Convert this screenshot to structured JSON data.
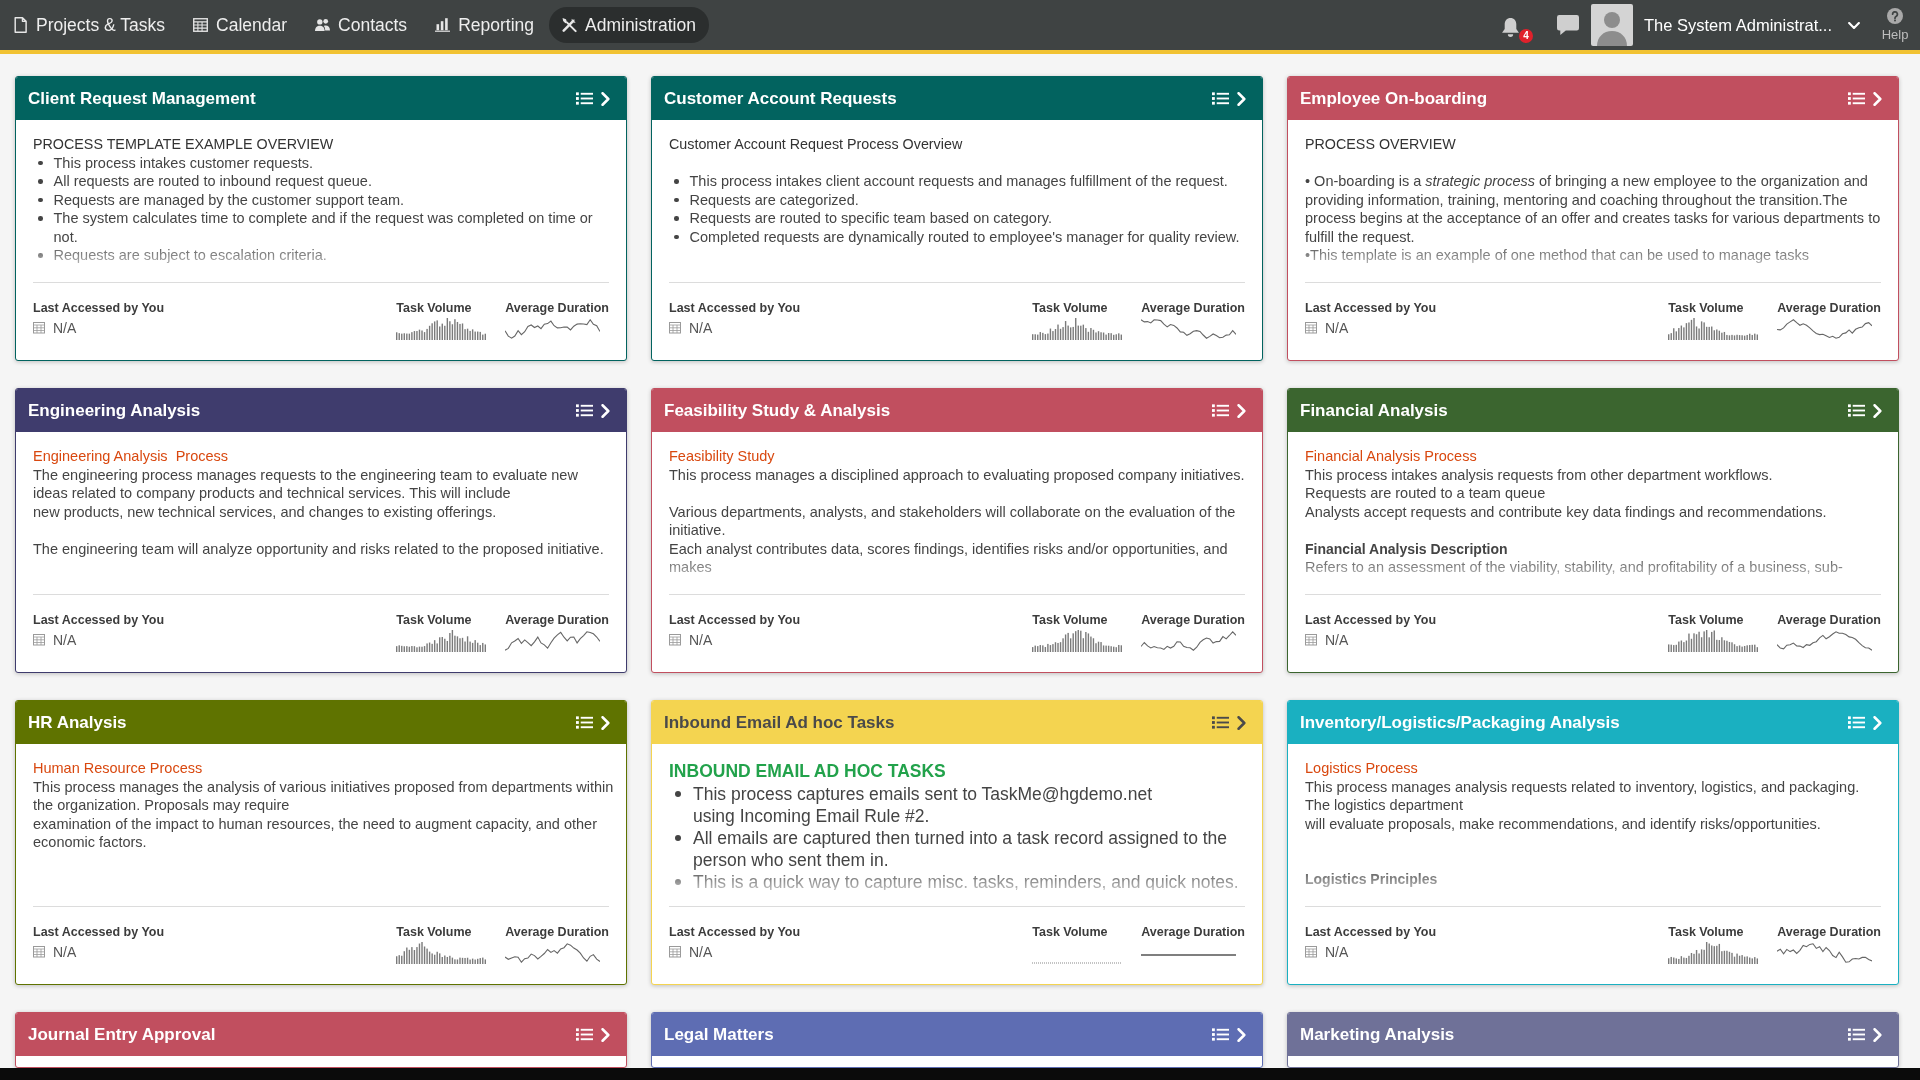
{
  "nav": {
    "items": [
      {
        "label": "Projects & Tasks",
        "selected": false
      },
      {
        "label": "Calendar",
        "selected": false
      },
      {
        "label": "Contacts",
        "selected": false
      },
      {
        "label": "Reporting",
        "selected": false
      },
      {
        "label": "Administration",
        "selected": true
      }
    ]
  },
  "notifications": {
    "count": "4"
  },
  "user": {
    "name": "The System Administrat..."
  },
  "help": {
    "label": "Help"
  },
  "cards": [
    {
      "title": "Client Request Management",
      "color": "#02635f",
      "body": [
        {
          "kind": "heading",
          "text": "PROCESS TEMPLATE EXAMPLE OVERVIEW"
        },
        {
          "kind": "bullets",
          "items": [
            "This process intakes customer requests.",
            "All requests are routed to inbound request queue.",
            "Requests are managed by the customer support team.",
            "The system calculates time to complete and if the request was completed on time or not.",
            "Requests are subject to escalation criteria."
          ]
        }
      ],
      "footer": {
        "last_accessed_label": "Last Accessed by You",
        "last_accessed_value": "N/A",
        "task_volume_label": "Task Volume",
        "average_duration_label": "Average Duration",
        "activity": true
      }
    },
    {
      "title": "Customer Account Requests",
      "color": "#02635f",
      "body": [
        {
          "kind": "heading",
          "text": "Customer Account Request Process Overview"
        },
        {
          "kind": "blank"
        },
        {
          "kind": "bullets",
          "items": [
            "This process intakes client account requests and manages fulfillment of the request.",
            "Requests are categorized.",
            "Requests are routed to specific team based on category.",
            "Completed requests are dynamically routed to employee's manager for quality review."
          ]
        }
      ],
      "footer": {
        "last_accessed_label": "Last Accessed by You",
        "last_accessed_value": "N/A",
        "task_volume_label": "Task Volume",
        "average_duration_label": "Average Duration",
        "activity": true
      }
    },
    {
      "title": "Employee On-boarding",
      "color": "#c14f5f",
      "body": [
        {
          "kind": "heading",
          "text": "PROCESS OVERVIEW"
        },
        {
          "kind": "blank"
        },
        {
          "kind": "paragraph",
          "text": "• On-boarding is a *strategic process* of bringing a new employee to the organization and providing information, training, mentoring and coaching throughout the transition.The process begins at the acceptance of an offer and creates tasks for various departments to fulfill the request."
        },
        {
          "kind": "paragraph",
          "text": "•This template is an example of one method that can be used to manage tasks"
        }
      ],
      "footer": {
        "last_accessed_label": "Last Accessed by You",
        "last_accessed_value": "N/A",
        "task_volume_label": "Task Volume",
        "average_duration_label": "Average Duration",
        "activity": true
      }
    },
    {
      "title": "Engineering Analysis",
      "color": "#3f3c6d",
      "body": [
        {
          "kind": "title",
          "text": "Engineering Analysis  Process"
        },
        {
          "kind": "paragraph",
          "text": "The engineering process manages requests to the engineering team to evaluate new ideas related to company products and technical services. This will include\nnew products, new technical services, and changes to existing offerings."
        },
        {
          "kind": "blank"
        },
        {
          "kind": "paragraph",
          "text": "The engineering team will analyze opportunity and risks related to the proposed initiative."
        }
      ],
      "footer": {
        "last_accessed_label": "Last Accessed by You",
        "last_accessed_value": "N/A",
        "task_volume_label": "Task Volume",
        "average_duration_label": "Average Duration",
        "activity": true
      }
    },
    {
      "title": "Feasibility Study & Analysis",
      "color": "#c14f5f",
      "body": [
        {
          "kind": "title",
          "text": "Feasibility Study"
        },
        {
          "kind": "paragraph",
          "text": "This process manages a disciplined approach to evaluating proposed company initiatives."
        },
        {
          "kind": "blank"
        },
        {
          "kind": "paragraph",
          "text": "Various departments, analysts, and stakeholders will collaborate on the evaluation of the initiative.\nEach analyst contributes data, scores findings, identifies risks and/or opportunities, and makes"
        }
      ],
      "footer": {
        "last_accessed_label": "Last Accessed by You",
        "last_accessed_value": "N/A",
        "task_volume_label": "Task Volume",
        "average_duration_label": "Average Duration",
        "activity": true
      }
    },
    {
      "title": "Financial Analysis",
      "color": "#3b652f",
      "body": [
        {
          "kind": "title",
          "text": "Financial Analysis Process"
        },
        {
          "kind": "paragraph",
          "text": "This process intakes analysis requests from other department workflows.\nRequests are routed to a team queue\nAnalysts accept requests and contribute key data findings and recommendations."
        },
        {
          "kind": "blank"
        },
        {
          "kind": "subheading",
          "text": "Financial Analysis Description"
        },
        {
          "kind": "paragraph",
          "text": "Refers to an assessment of the viability, stability, and profitability of a business, sub-"
        }
      ],
      "footer": {
        "last_accessed_label": "Last Accessed by You",
        "last_accessed_value": "N/A",
        "task_volume_label": "Task Volume",
        "average_duration_label": "Average Duration",
        "activity": true
      }
    },
    {
      "title": "HR Analysis",
      "color": "#5f7300",
      "body": [
        {
          "kind": "title",
          "text": "Human Resource Process"
        },
        {
          "kind": "paragraph",
          "text": "This process manages the analysis of various initiatives proposed from departments within the organization. Proposals may require\nexamination of the impact to human resources, the need to augment capacity, and other economic factors."
        }
      ],
      "footer": {
        "last_accessed_label": "Last Accessed by You",
        "last_accessed_value": "N/A",
        "task_volume_label": "Task Volume",
        "average_duration_label": "Average Duration",
        "activity": true
      }
    },
    {
      "title": "Inbound Email Ad hoc Tasks",
      "color": "#f4d450",
      "body": [
        {
          "kind": "banner",
          "text": "INBOUND EMAIL AD HOC TASKS"
        },
        {
          "kind": "large-bullets",
          "items": [
            "This process captures emails sent to TaskMe@hgdemo.net\nusing Incoming Email Rule #2.",
            "All emails are captured then turned into a task record assigned to the person who sent them in.",
            "This is a quick way to capture misc. tasks, reminders, and quick notes."
          ]
        }
      ],
      "footer": {
        "last_accessed_label": "Last Accessed by You",
        "last_accessed_value": "N/A",
        "task_volume_label": "Task Volume",
        "average_duration_label": "Average Duration",
        "activity": false
      }
    },
    {
      "title": "Inventory/Logistics/Packaging Analysis",
      "color": "#1ab0c1",
      "body": [
        {
          "kind": "title",
          "text": "Logistics Process"
        },
        {
          "kind": "paragraph",
          "text": "This process manages analysis requests related to inventory, logistics, and packaging.\nThe logistics department\nwill evaluate proposals, make recommendations, and identify risks/opportunities."
        },
        {
          "kind": "blank"
        },
        {
          "kind": "blank"
        },
        {
          "kind": "subheading",
          "text": "Logistics Principles"
        }
      ],
      "footer": {
        "last_accessed_label": "Last Accessed by You",
        "last_accessed_value": "N/A",
        "task_volume_label": "Task Volume",
        "average_duration_label": "Average Duration",
        "activity": true
      }
    },
    {
      "title": "Journal Entry Approval",
      "color": "#c14f5f"
    },
    {
      "title": "Legal Matters",
      "color": "#5e6db3"
    },
    {
      "title": "Marketing Analysis",
      "color": "#6f7198"
    }
  ]
}
